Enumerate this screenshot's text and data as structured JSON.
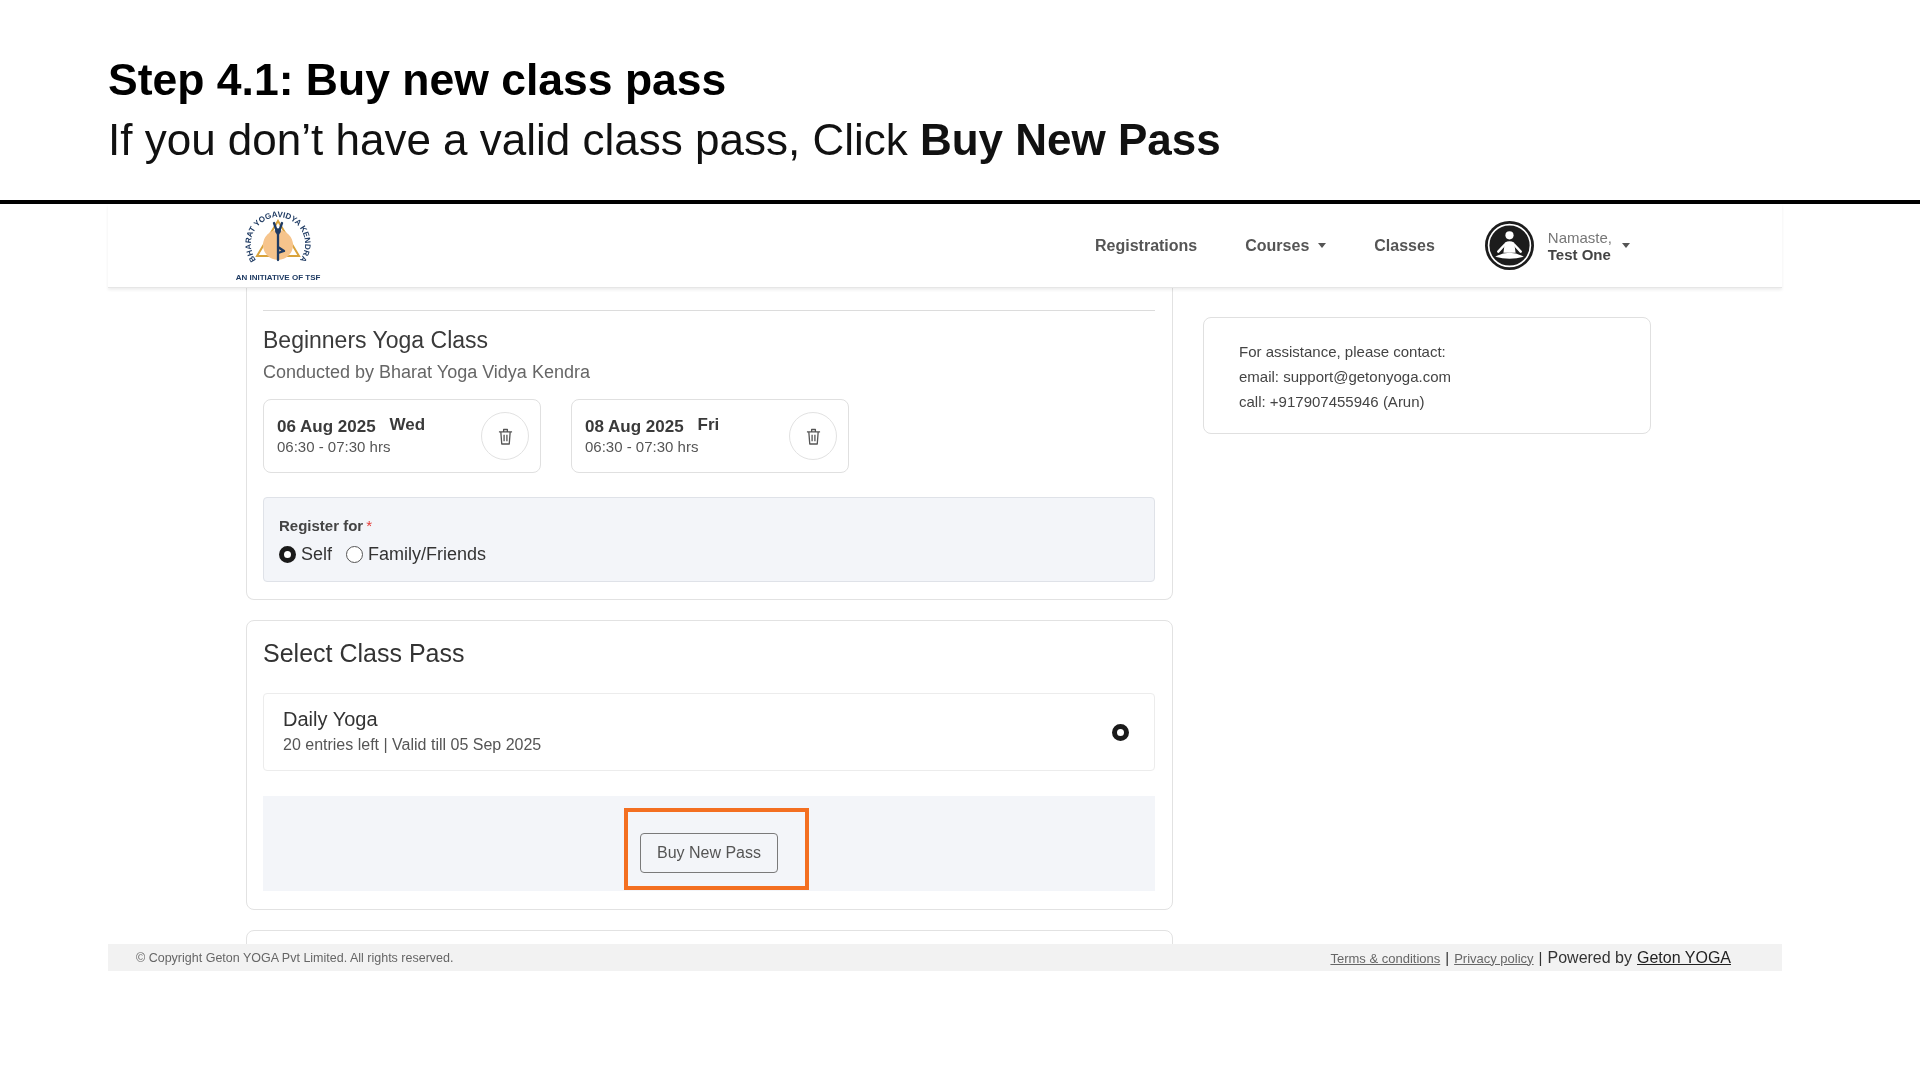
{
  "slide": {
    "heading": "Step 4.1: Buy new class pass",
    "instruction": "If you don’t have a valid class pass, Click **Buy New Pass**"
  },
  "navbar": {
    "logo": {
      "name": "BHARAT YOGAVIDYA KENDRA",
      "tagline": "AN INITIATIVE OF TSF"
    },
    "items": [
      {
        "label": "Registrations",
        "dropdown": false
      },
      {
        "label": "Courses",
        "dropdown": true
      },
      {
        "label": "Classes",
        "dropdown": false
      }
    ],
    "user": {
      "greeting": "Namaste,",
      "name": "Test One",
      "dropdown": true
    }
  },
  "course": {
    "title": "Beginners Yoga Class",
    "conductor": "Conducted by Bharat Yoga Vidya Kendra",
    "sessions": [
      {
        "date": "06 Aug 2025",
        "day": "Wed",
        "time": "06:30 - 07:30 hrs"
      },
      {
        "date": "08 Aug 2025",
        "day": "Fri",
        "time": "06:30 - 07:30 hrs"
      }
    ],
    "register_for": {
      "label": "Register for",
      "required_mark": "*",
      "options": [
        {
          "label": "Self",
          "selected": true
        },
        {
          "label": "Family/Friends",
          "selected": false
        }
      ]
    }
  },
  "class_pass": {
    "title": "Select Class Pass",
    "passes": [
      {
        "name": "Daily Yoga",
        "details": "20 entries left | Valid till 05 Sep 2025",
        "selected": true
      }
    ],
    "buy_button": {
      "label": "Buy New Pass",
      "highlighted": true
    }
  },
  "assistance": {
    "lines": [
      "For assistance, please contact:",
      "email: support@getonyoga.com",
      "call: +917907455946 (Arun)"
    ]
  },
  "footer": {
    "copyright": "© Copyright Geton YOGA Pvt Limited. All rights reserved.",
    "parts": [
      {
        "kind": "link",
        "text": "Terms & conditions"
      },
      {
        "kind": "separator",
        "text": "|"
      },
      {
        "kind": "link",
        "text": "Privacy policy"
      },
      {
        "kind": "separator",
        "text": "|"
      },
      {
        "kind": "text",
        "text": "Powered by"
      },
      {
        "kind": "brand",
        "text": "Geton YOGA"
      }
    ]
  }
}
